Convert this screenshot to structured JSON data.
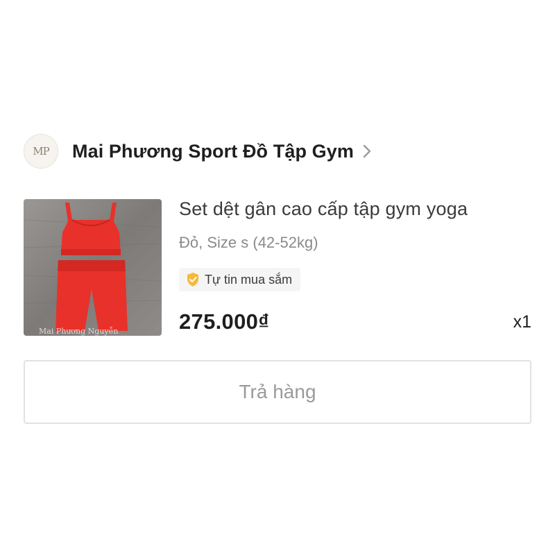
{
  "shop": {
    "avatar_text": "MP",
    "name": "Mai Phương Sport Đồ Tập Gym",
    "chevron_icon": "chevron-right-icon"
  },
  "product": {
    "title": "Set dệt gân cao cấp tập gym yoga",
    "variant": "Đỏ, Size s (42-52kg)",
    "badge": {
      "icon": "shield-check-icon",
      "label": "Tự tin mua sắm",
      "icon_color": "#f5b93b"
    },
    "price": "275.000₫",
    "quantity": "x1",
    "image": {
      "watermark": "Mai Phương Nguyễn",
      "garment_color": "#e8312a",
      "background_color": "#8a8684"
    }
  },
  "actions": {
    "return_label": "Trả hàng"
  }
}
